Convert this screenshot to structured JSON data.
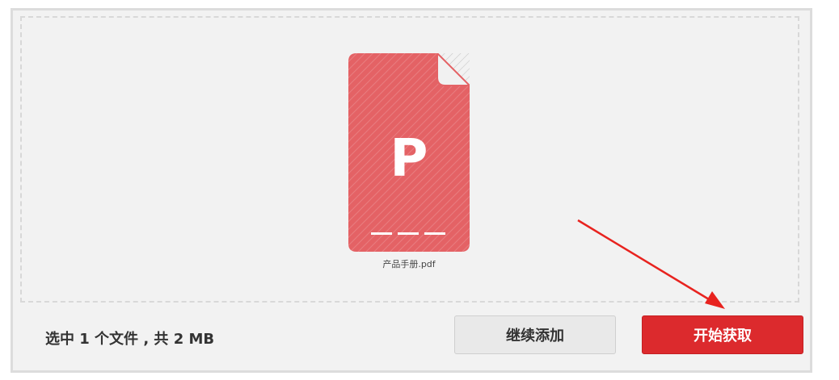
{
  "file": {
    "name": "产品手册.pdf",
    "icon_letter": "P",
    "icon": "pdf-file-icon",
    "icon_color": "#e46265"
  },
  "footer": {
    "selection_summary": "选中 1 个文件 , 共 2 MB",
    "continue_add_label": "继续添加",
    "start_label": "开始获取"
  },
  "colors": {
    "primary_button": "#dc2a2d",
    "annotation_arrow": "#e8231f",
    "panel_background": "#f2f2f2"
  }
}
